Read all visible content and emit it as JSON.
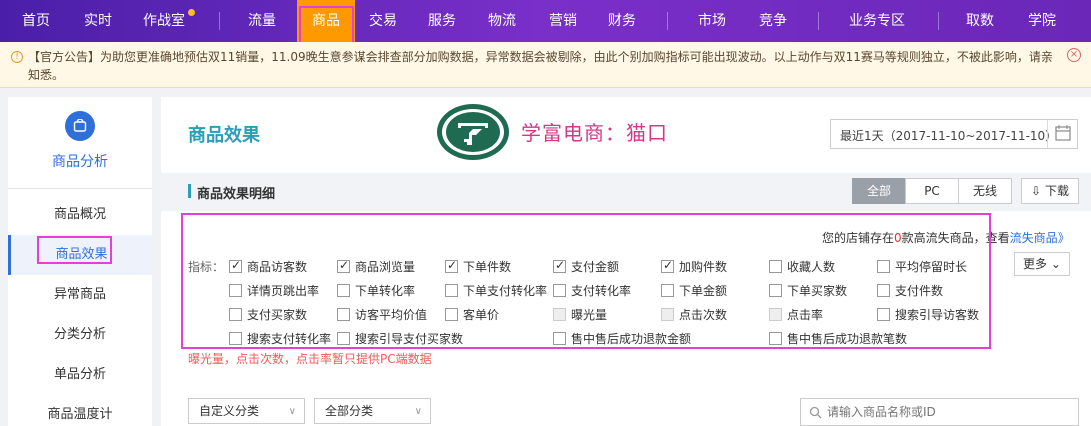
{
  "topnav": {
    "items": [
      "首页",
      "实时",
      "作战室",
      "流量",
      "商品",
      "交易",
      "服务",
      "物流",
      "营销",
      "财务",
      "市场",
      "竞争",
      "业务专区",
      "取数",
      "学院"
    ]
  },
  "notice": {
    "text": "【官方公告】为助您更准确地预估双11销量，11.09晚生意参谋会排查部分加购数据，异常数据会被剔除，由此个别加购指标可能出现波动。以上动作与双11赛马等规则独立，不被此影响，请亲知悉。",
    "close": "×",
    "icon": "!"
  },
  "sidebar": {
    "title": "商品分析",
    "items": [
      "商品概况",
      "商品效果",
      "异常商品",
      "分类分析",
      "单品分析",
      "商品温度计"
    ]
  },
  "main": {
    "title": "商品效果",
    "brand": "学富电商：猫口",
    "date": "最近1天（2017-11-10~2017-11-10）",
    "section_title": "商品效果明细",
    "segments": [
      "全部",
      "PC",
      "无线"
    ],
    "download": "下载",
    "more": "更多",
    "metric_label": "指标：",
    "store_note": {
      "pre": "您的店铺存在",
      "num": "0",
      "mid": "款高流失商品，查看",
      "link": "流失商品",
      "post": "》"
    },
    "warning": "曝光量，点击次数，点击率暂只提供PC端数据",
    "filters": [
      "自定义分类",
      "全部分类"
    ],
    "search_placeholder": "请输入商品名称或ID"
  },
  "metrics": [
    {
      "label": "商品访客数",
      "checked": true
    },
    {
      "label": "商品浏览量",
      "checked": true
    },
    {
      "label": "下单件数",
      "checked": true
    },
    {
      "label": "支付金额",
      "checked": true
    },
    {
      "label": "加购件数",
      "checked": true
    },
    {
      "label": "收藏人数",
      "checked": false
    },
    {
      "label": "平均停留时长",
      "checked": false
    },
    {
      "label": "详情页跳出率",
      "checked": false
    },
    {
      "label": "下单转化率",
      "checked": false
    },
    {
      "label": "下单支付转化率",
      "checked": false
    },
    {
      "label": "支付转化率",
      "checked": false
    },
    {
      "label": "下单金额",
      "checked": false
    },
    {
      "label": "下单买家数",
      "checked": false
    },
    {
      "label": "支付件数",
      "checked": false
    },
    {
      "label": "支付买家数",
      "checked": false
    },
    {
      "label": "访客平均价值",
      "checked": false
    },
    {
      "label": "客单价",
      "checked": false
    },
    {
      "label": "曝光量",
      "checked": false
    },
    {
      "label": "点击次数",
      "checked": false
    },
    {
      "label": "点击率",
      "checked": false
    },
    {
      "label": "搜索引导访客数",
      "checked": false
    },
    {
      "label": "搜索支付转化率",
      "checked": false
    },
    {
      "label": "搜索引导支付买家数",
      "checked": false
    },
    {
      "label": "售中售后成功退款金额",
      "checked": false
    },
    {
      "label": "售中售后成功退款笔数",
      "checked": false
    }
  ],
  "colors": {
    "accent": "#2aa0b7",
    "primary": "#2f6fd9",
    "highlight": "#e53fd8",
    "brand": "#d4378a",
    "nav": "#6a27b8"
  }
}
